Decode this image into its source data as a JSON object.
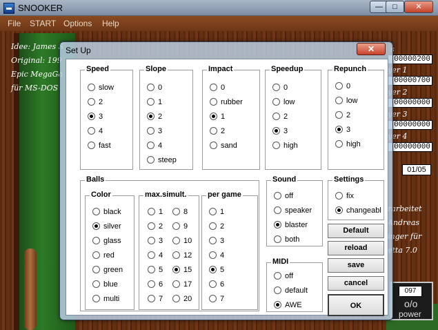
{
  "window": {
    "title": "SNOOKER",
    "minimize": "—",
    "maximize": "□",
    "close": "✕"
  },
  "menu": [
    "File",
    "START",
    "Options",
    "Help"
  ],
  "background": {
    "credits_left": [
      "Idee: James S",
      "Original: 199",
      "Epic MegaGa",
      "für MS-DOS"
    ],
    "score_label_top": "s",
    "scores": [
      "00000200",
      "00000700",
      "00000000",
      "00000000",
      "00000000"
    ],
    "player_labels": [
      "yer 1",
      "yer 2",
      "yer 3",
      "yer 4"
    ],
    "frames": "01/05",
    "credits_right": [
      "rarbeitet",
      "Andreas",
      "inger für",
      "etta 7.0"
    ],
    "power": {
      "value": "097",
      "symbol": "o/o",
      "label": "power"
    }
  },
  "dialog": {
    "title": "Set Up",
    "close": "✕",
    "speed": {
      "title": "Speed",
      "options": [
        "slow",
        "2",
        "3",
        "4",
        "fast"
      ],
      "selected": 2
    },
    "slope": {
      "title": "Slope",
      "options": [
        "0",
        "1",
        "2",
        "3",
        "4",
        "steep"
      ],
      "selected": 2
    },
    "impact": {
      "title": "Impact",
      "options": [
        "0",
        "rubber",
        "1",
        "2",
        "sand"
      ],
      "selected": 2
    },
    "speedup": {
      "title": "Speedup",
      "options": [
        "0",
        "low",
        "2",
        "3",
        "high"
      ],
      "selected": 3
    },
    "repunch": {
      "title": "Repunch",
      "options": [
        "0",
        "low",
        "2",
        "3",
        "high"
      ],
      "selected": 3
    },
    "balls": {
      "title": "Balls",
      "color": {
        "title": "Color",
        "options": [
          "black",
          "silver",
          "glass",
          "red",
          "green",
          "blue",
          "multi"
        ],
        "selected": 1
      },
      "max_simult": {
        "title": "max.simult.",
        "col1": [
          "1",
          "2",
          "3",
          "4",
          "5",
          "6",
          "7"
        ],
        "col2": [
          "8",
          "9",
          "10",
          "12",
          "15",
          "17",
          "20"
        ],
        "selected": "15"
      },
      "per_game": {
        "title": "per game",
        "options": [
          "1",
          "2",
          "3",
          "4",
          "5",
          "6",
          "7"
        ],
        "selected": 4
      }
    },
    "sound": {
      "title": "Sound",
      "options": [
        "off",
        "speaker",
        "blaster",
        "both"
      ],
      "selected": 2
    },
    "settings": {
      "title": "Settings",
      "options": [
        "fix",
        "changeabl"
      ],
      "selected": 1
    },
    "midi": {
      "title": "MIDI",
      "options": [
        "off",
        "default",
        "AWE"
      ],
      "selected": 2
    },
    "buttons": {
      "default": "Default",
      "reload": "reload",
      "save": "save",
      "cancel": "cancel",
      "ok": "OK"
    }
  }
}
